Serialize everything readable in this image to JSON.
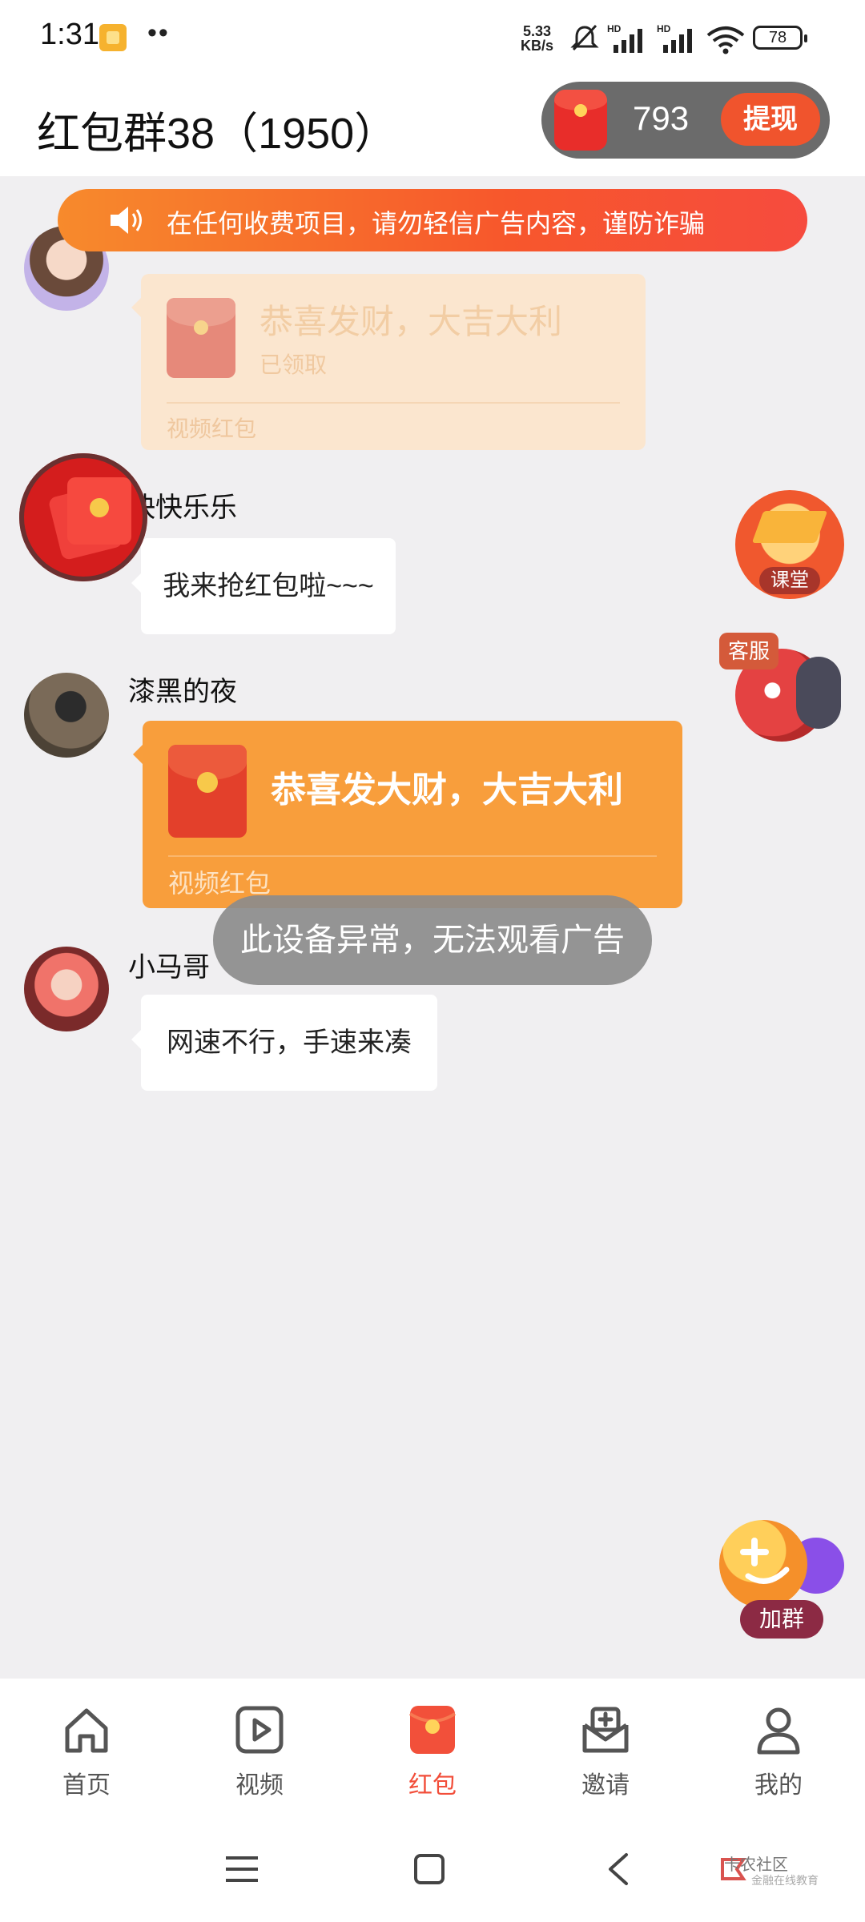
{
  "status_bar": {
    "time": "1:31",
    "dots": "••",
    "net_speed_value": "5.33",
    "net_speed_unit": "KB/s",
    "battery": "78"
  },
  "header": {
    "title": "红包群38（1950）",
    "balance": "793",
    "withdraw_label": "提现"
  },
  "notice": {
    "text": "在任何收费项目，请勿轻信广告内容，谨防诈骗"
  },
  "messages": [
    {
      "type": "red_packet",
      "title": "恭喜发财，大吉大利",
      "status": "已领取",
      "footer": "视频红包"
    },
    {
      "type": "text",
      "name": "快快乐乐",
      "text": "我来抢红包啦~~~"
    },
    {
      "type": "red_packet",
      "name": "漆黑的夜",
      "title": "恭喜发大财，大吉大利",
      "footer": "视频红包"
    },
    {
      "type": "text",
      "name": "小马哥",
      "text": "网速不行，手速来凑"
    }
  ],
  "toast": "此设备异常，无法观看广告",
  "floating": {
    "class_label": "课堂",
    "service_label": "客服",
    "join_group_label": "加群"
  },
  "nav": {
    "items": [
      {
        "label": "首页",
        "icon": "home-icon"
      },
      {
        "label": "视频",
        "icon": "video-icon"
      },
      {
        "label": "红包",
        "icon": "red-packet-icon",
        "active": true
      },
      {
        "label": "邀请",
        "icon": "invite-icon"
      },
      {
        "label": "我的",
        "icon": "profile-icon"
      }
    ]
  },
  "system_bar": {
    "watermark": "卡农社区",
    "watermark_sub": "金融在线教育"
  },
  "colors": {
    "accent": "#f24e3a",
    "notice_gradient_start": "#f78a2c",
    "red_packet_orange": "#f89e3c"
  }
}
